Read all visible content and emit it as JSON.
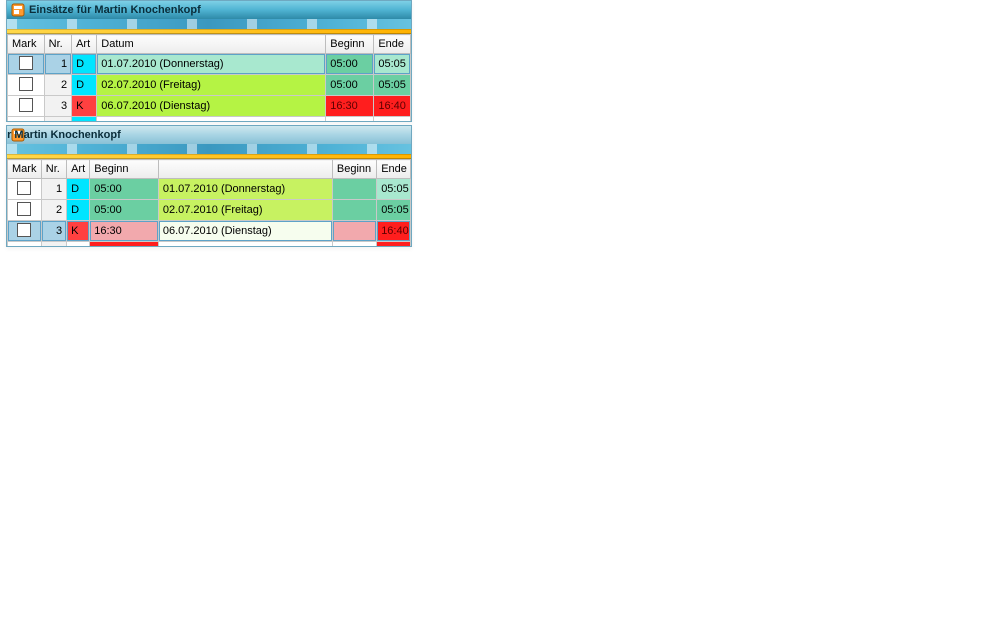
{
  "panel_a": {
    "title": "Einsätze für Martin Knochenkopf",
    "columns": {
      "mark": "Mark",
      "nr": "Nr.",
      "art": "Art",
      "wide": "Datum",
      "narrow": "Beginn",
      "end": "Ende"
    },
    "rows": [
      {
        "nr": "1",
        "art": "D",
        "wide": "01.07.2010 (Donnerstag)",
        "narrow": "05:00",
        "end": "05:05",
        "cls": {
          "mark": "cell-selected",
          "nr": "cell-selected",
          "art": "cell-cyan",
          "wide": "cell-mint",
          "narrow": "cell-mint2",
          "end": "cell-mint"
        }
      },
      {
        "nr": "2",
        "art": "D",
        "wide": "02.07.2010 (Freitag)",
        "narrow": "05:00",
        "end": "05:05",
        "cls": {
          "mark": "cell-white",
          "nr": "cell-nr",
          "art": "cell-cyan",
          "wide": "cell-lime",
          "narrow": "cell-mint2",
          "end": "cell-mint2"
        }
      },
      {
        "nr": "3",
        "art": "K",
        "wide": "06.07.2010 (Dienstag)",
        "narrow": "16:30",
        "end": "16:40",
        "cls": {
          "mark": "cell-white",
          "nr": "cell-nr",
          "art": "cell-red2",
          "wide": "cell-lime",
          "narrow": "cell-red",
          "end": "cell-red"
        }
      }
    ]
  },
  "panel_b": {
    "title": "Einsätze für Martin Knochenkopf",
    "columns": {
      "mark": "Mark",
      "nr": "Nr.",
      "art": "Art",
      "narrow": "Beginn",
      "wide": " ",
      "narrow2": "Beginn",
      "end": "Ende"
    },
    "rows": [
      {
        "nr": "1",
        "art": "D",
        "narrow": "05:00",
        "wide": "01.07.2010 (Donnerstag)",
        "end": "05:05",
        "cls": {
          "mark": "cell-white",
          "nr": "cell-nr",
          "art": "cell-cyan",
          "narrow": "cell-mint2",
          "wide": "cell-lime2",
          "end": "cell-mint"
        }
      },
      {
        "nr": "2",
        "art": "D",
        "narrow": "05:00",
        "wide": "02.07.2010 (Freitag)",
        "end": "05:05",
        "cls": {
          "mark": "cell-white",
          "nr": "cell-nr",
          "art": "cell-cyan",
          "narrow": "cell-mint2",
          "wide": "cell-lime2",
          "end": "cell-mint2"
        }
      },
      {
        "nr": "3",
        "art": "K",
        "narrow": "16:30",
        "wide": "06.07.2010 (Dienstag)",
        "end": "16:40",
        "cls": {
          "mark": "cell-selected",
          "nr": "cell-selected",
          "art": "cell-red2",
          "narrow": "cell-rose",
          "wide": "cell-pale",
          "end": "cell-red"
        }
      }
    ]
  }
}
